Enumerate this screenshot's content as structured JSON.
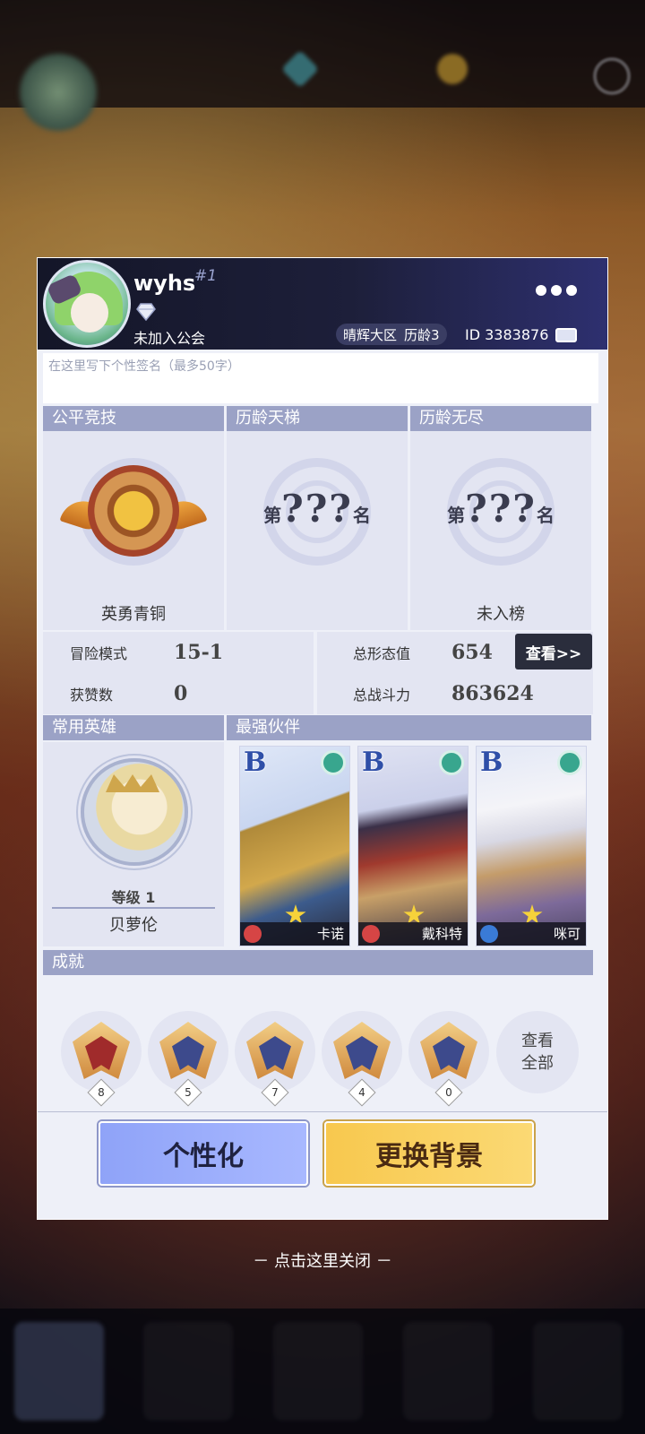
{
  "profile": {
    "username": "wyhs",
    "rank_tag": "#1",
    "guild": "未加入公会",
    "server": "晴辉大区",
    "age": "历龄3",
    "uid": "ID 3383876",
    "signature_placeholder": "在这里写下个性签名（最多50字）"
  },
  "sections": {
    "fair": "公平竞技",
    "ladder": "历龄天梯",
    "endless": "历龄无尽",
    "common_hero": "常用英雄",
    "strongest": "最强伙伴",
    "achievements": "成就"
  },
  "ranks": {
    "fair_label": "英勇青铜",
    "ladder_prefix": "第",
    "ladder_value": "???",
    "ladder_suffix": "名",
    "endless_prefix": "第",
    "endless_value": "???",
    "endless_suffix": "名",
    "endless_label": "未入榜"
  },
  "stats": {
    "adventure_label": "冒险模式",
    "adventure_value": "15-1",
    "likes_label": "获赞数",
    "likes_value": "0",
    "form_label": "总形态值",
    "form_value": "654",
    "power_label": "总战斗力",
    "power_value": "863624",
    "view_button": "查看>>"
  },
  "hero": {
    "level": "等级 1",
    "name": "贝萝伦"
  },
  "partners": [
    {
      "grade": "B",
      "name": "卡诺",
      "cls_color": "#d64545"
    },
    {
      "grade": "B",
      "name": "戴科特",
      "cls_color": "#d64545"
    },
    {
      "grade": "B",
      "name": "咪可",
      "cls_color": "#3a7bd6"
    }
  ],
  "achievements": {
    "items": [
      {
        "count": "8"
      },
      {
        "count": "5"
      },
      {
        "count": "7"
      },
      {
        "count": "4"
      },
      {
        "count": "0"
      }
    ],
    "view_all_1": "查看",
    "view_all_2": "全部"
  },
  "buttons": {
    "personalize": "个性化",
    "change_bg": "更换背景"
  },
  "close_hint": "－ 点击这里关闭 －"
}
